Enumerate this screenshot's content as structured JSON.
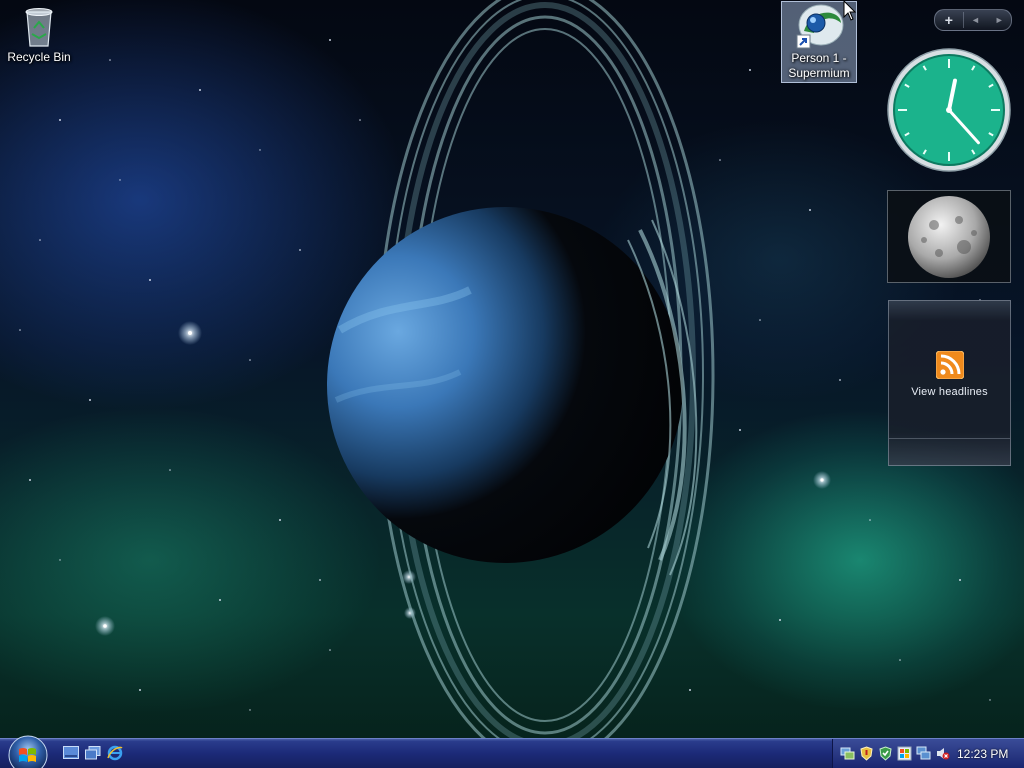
{
  "desktop": {
    "icons": [
      {
        "label": "Recycle Bin",
        "icon": "recycle-bin-icon"
      },
      {
        "label": "Person 1 -\nSupermium",
        "icon": "supermium-browser-shortcut-icon",
        "selected": true
      }
    ]
  },
  "sidebar": {
    "controls": {
      "add_label": "+",
      "prev_label": "◄",
      "next_label": "►"
    },
    "clock": {
      "hour": 12,
      "minute": 23,
      "face_color": "#1bb38c"
    },
    "slideshow": {
      "icon": "moon-image"
    },
    "feed": {
      "link_label": "View headlines",
      "icon": "rss-feed-icon",
      "accent": "#f08a1c"
    }
  },
  "taskbar": {
    "start_icon": "windows-orb-icon",
    "quick_launch": [
      {
        "icon": "show-desktop-icon"
      },
      {
        "icon": "switch-windows-icon"
      },
      {
        "icon": "internet-explorer-icon"
      }
    ],
    "tray": [
      {
        "icon": "network-sync-icon"
      },
      {
        "icon": "security-shield-icon"
      },
      {
        "icon": "defender-check-icon"
      },
      {
        "icon": "windows-update-icon"
      },
      {
        "icon": "network-connection-icon"
      },
      {
        "icon": "volume-muted-icon"
      }
    ],
    "time": "12:23 PM"
  },
  "colors": {
    "taskbar": "#1c2a78",
    "selection": "#96aac8"
  }
}
